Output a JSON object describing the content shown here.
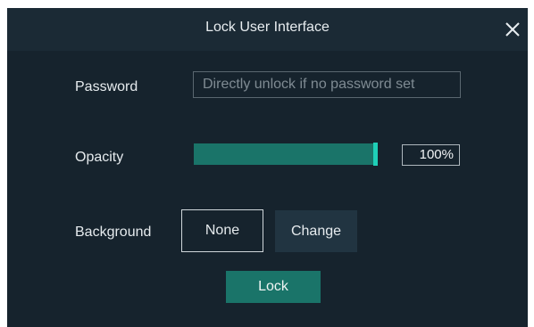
{
  "dialog": {
    "title": "Lock User Interface",
    "close_icon": "close-icon"
  },
  "password": {
    "label": "Password",
    "value": "",
    "placeholder": "Directly unlock if no password set"
  },
  "opacity": {
    "label": "Opacity",
    "level_percent": 100,
    "display": "100%"
  },
  "background": {
    "label": "Background",
    "none_label": "None",
    "change_label": "Change",
    "selected": "None"
  },
  "lock_button": {
    "label": "Lock"
  },
  "colors": {
    "dialog_bg": "#16232d",
    "titlebar_bg": "#1b2a35",
    "accent": "#1a7469",
    "slider_handle": "#1fd0b8"
  }
}
